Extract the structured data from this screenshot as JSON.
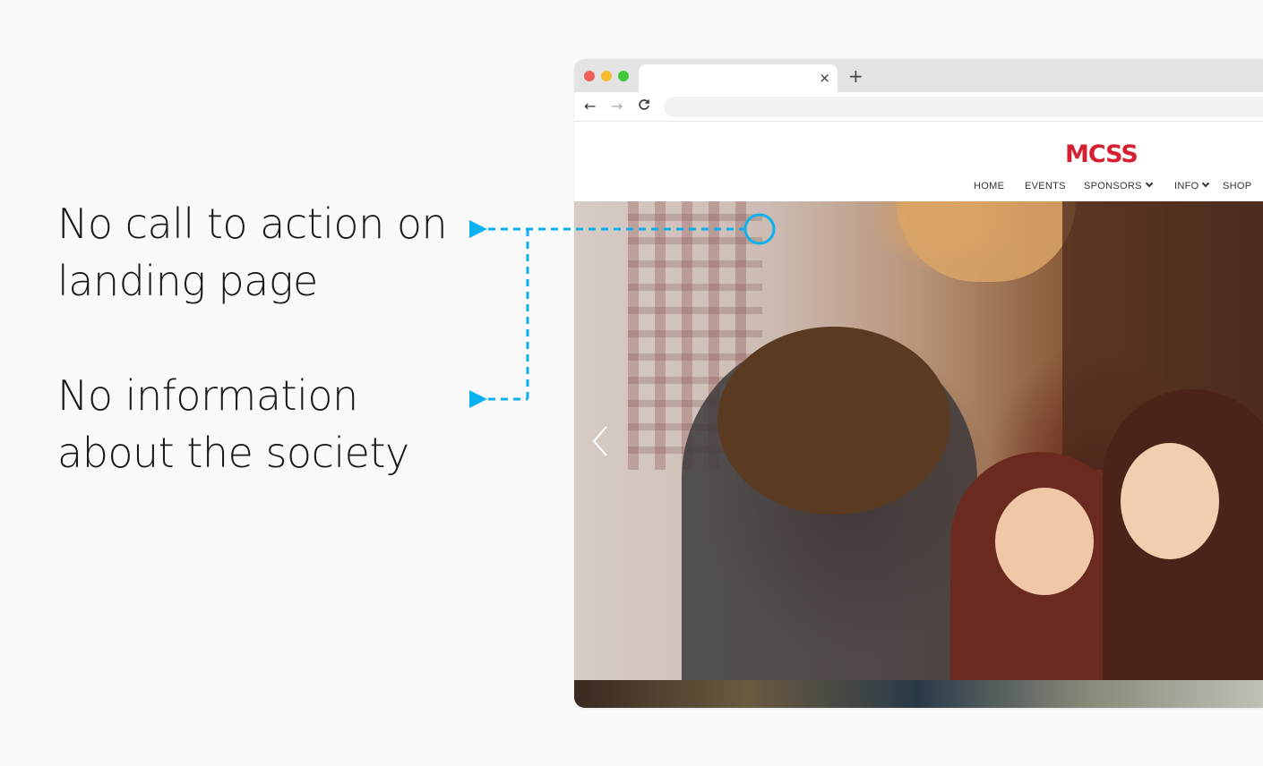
{
  "annotations": {
    "note_1": {
      "line_1": "No call to action on",
      "line_2": "landing page"
    },
    "note_2": {
      "line_1": "No information",
      "line_2": "about the society"
    },
    "accent_color": "#0ab0f0"
  },
  "browser": {
    "tab_close_glyph": "×",
    "new_tab_glyph": "+",
    "back_glyph": "←",
    "forward_glyph": "→",
    "reload_glyph": "C"
  },
  "site": {
    "logo": "MCSS",
    "logo_color": "#d42030",
    "nav": {
      "home": "HOME",
      "events": "EVENTS",
      "sponsors": "SPONSORS",
      "info": "INFO",
      "shop": "SHOP"
    }
  },
  "icons": {
    "hero_prev": "chevron-left-icon",
    "dropdown": "chevron-down-icon"
  }
}
